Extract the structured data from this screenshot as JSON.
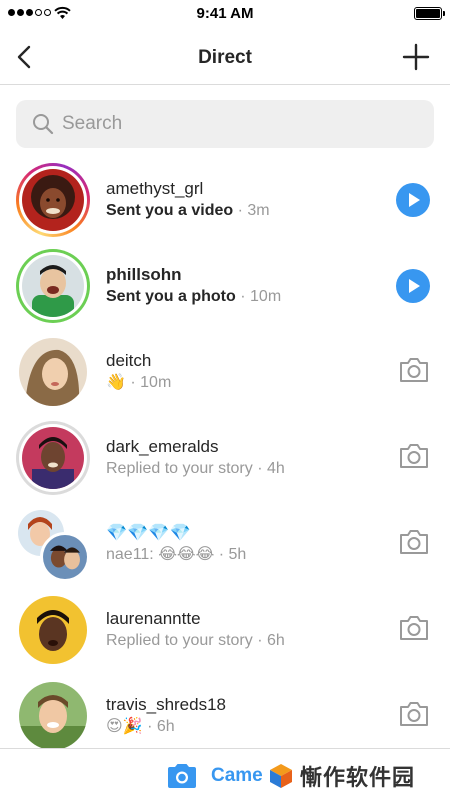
{
  "status_bar": {
    "time": "9:41 AM"
  },
  "nav": {
    "title": "Direct"
  },
  "search": {
    "placeholder": "Search"
  },
  "threads": [
    {
      "username": "amethyst_grl",
      "message": "Sent you a video",
      "time": "3m",
      "action": "play"
    },
    {
      "username": "phillsohn",
      "message": "Sent you a photo",
      "time": "10m",
      "action": "play"
    },
    {
      "username": "deitch",
      "message": "👋",
      "time": "10m",
      "action": "camera"
    },
    {
      "username": "dark_emeralds",
      "message": "Replied to your story",
      "time": "4h",
      "action": "camera"
    },
    {
      "username": "💎💎💎💎",
      "message": "nae11: 😂😂😂",
      "time": "5h",
      "action": "camera"
    },
    {
      "username": "laurenanntte",
      "message": "Replied to your story",
      "time": "6h",
      "action": "camera"
    },
    {
      "username": "travis_shreds18",
      "message": "😍🎉",
      "time": "6h",
      "action": "camera"
    }
  ],
  "separator": "·",
  "bottom_bar": {
    "label": "Camera"
  },
  "watermark": {
    "text": "慚作软件园"
  },
  "colors": {
    "accent": "#3897f0",
    "unread_ring": "#6ccf54"
  }
}
